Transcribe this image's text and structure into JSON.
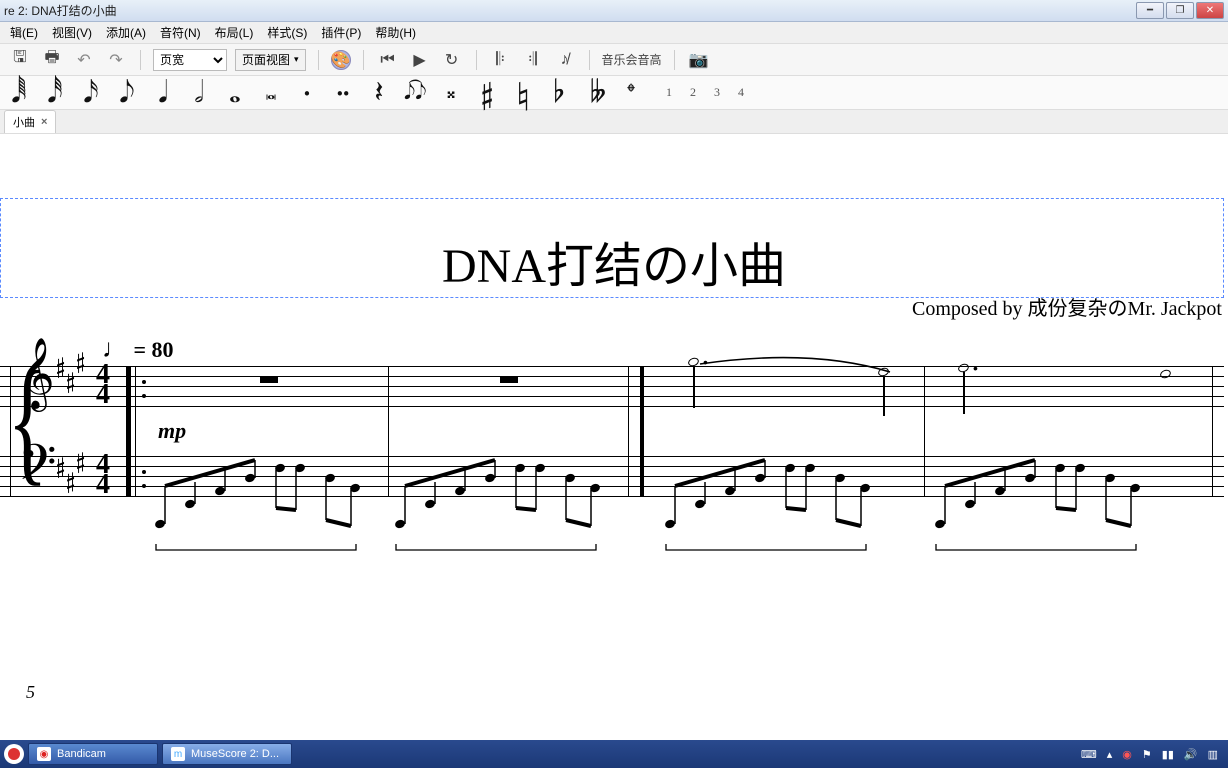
{
  "window": {
    "title": "re 2: DNA打结の小曲"
  },
  "menu": [
    "辑(E)",
    "视图(V)",
    "添加(A)",
    "音符(N)",
    "布局(L)",
    "样式(S)",
    "插件(P)",
    "帮助(H)"
  ],
  "toolbar": {
    "zoom_select": "页宽",
    "view_button": "页面视图",
    "concert_label": "音乐会音高"
  },
  "palette": {
    "nums": [
      "1",
      "2",
      "3",
      "4"
    ]
  },
  "doctab": {
    "label": "小曲",
    "close": "×"
  },
  "score": {
    "title": "DNA打结の小曲",
    "composer": "Composed by 成份复杂のMr. Jackpot",
    "tempo_note": "♩",
    "tempo_eq": " = 80",
    "dynamic": "mp",
    "time_top": "4",
    "time_bot": "4",
    "measno": "5"
  },
  "taskbar": {
    "bandicam": "Bandicam",
    "musescore": "MuseScore 2: D..."
  }
}
